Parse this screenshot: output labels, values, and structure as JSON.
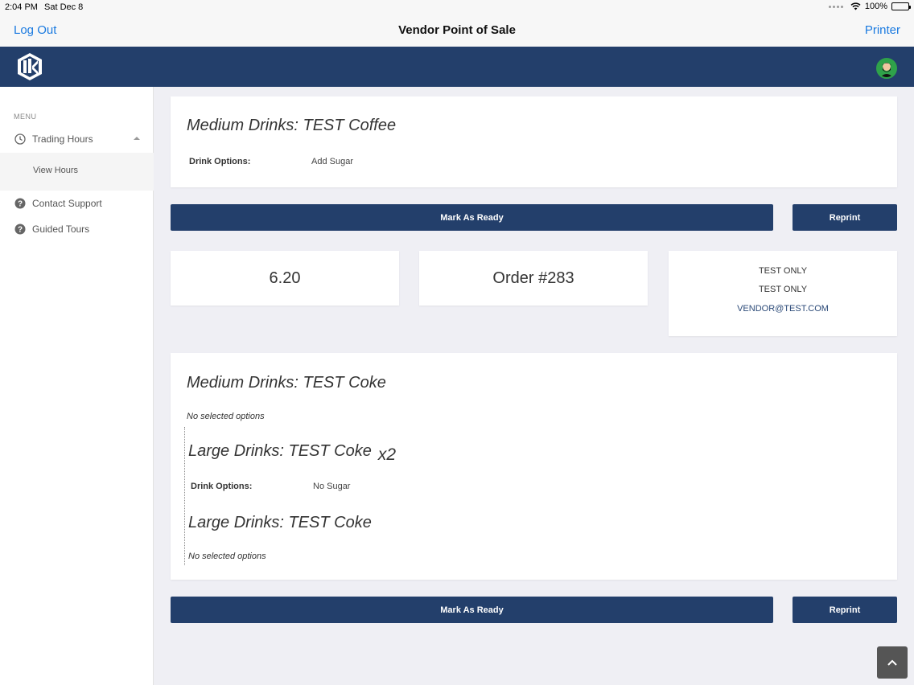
{
  "status": {
    "time": "2:04 PM",
    "date": "Sat Dec 8",
    "battery": "100%"
  },
  "nav": {
    "left": "Log Out",
    "title": "Vendor Point of Sale",
    "right": "Printer"
  },
  "sidebar": {
    "menu_label": "MENU",
    "items": [
      {
        "label": "Trading Hours",
        "icon": "clock-icon"
      },
      {
        "label": "View Hours"
      },
      {
        "label": "Contact Support",
        "icon": "help-icon"
      },
      {
        "label": "Guided Tours",
        "icon": "help-icon"
      }
    ]
  },
  "order1": {
    "item_title": "Medium Drinks: TEST Coffee",
    "option_key": "Drink Options:",
    "option_value": "Add Sugar",
    "ready_label": "Mark As Ready",
    "reprint_label": "Reprint"
  },
  "summary": {
    "total": "6.20",
    "order_number": "Order #283",
    "customer_lines": [
      "TEST ONLY",
      "TEST ONLY",
      "VENDOR@TEST.COM"
    ]
  },
  "order2": {
    "item_title": "Medium Drinks: TEST Coke",
    "no_options": "No selected options",
    "sub_items": [
      {
        "title": "Large Drinks: TEST Coke",
        "qty": "x2",
        "option_key": "Drink Options:",
        "option_value": "No Sugar"
      },
      {
        "title": "Large Drinks: TEST Coke",
        "no_options": "No selected options"
      }
    ],
    "ready_label": "Mark As Ready",
    "reprint_label": "Reprint"
  },
  "colors": {
    "brand_navy": "#233f6b",
    "ios_link": "#1a7ae0"
  }
}
